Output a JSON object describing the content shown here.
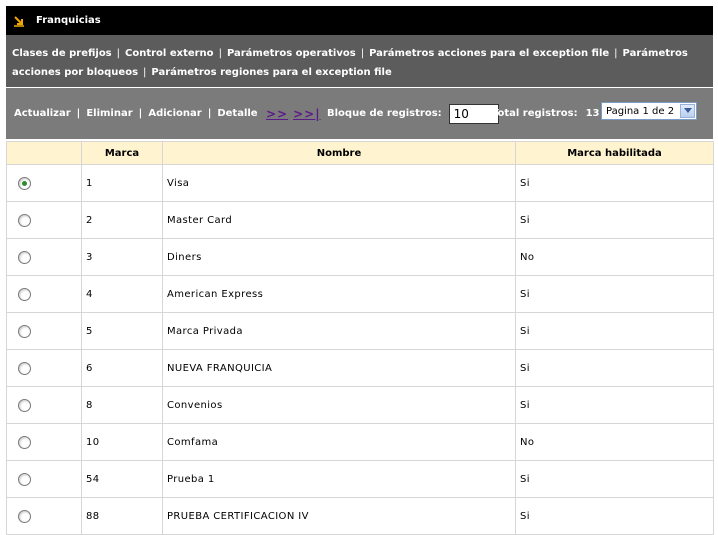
{
  "header": {
    "title": "Franquicias",
    "icon": "arrow-down-right-icon"
  },
  "nav": {
    "links": [
      "Clases de prefijos",
      "Control externo",
      "Parámetros operativos",
      "Parámetros acciones para el exception file",
      "Parámetros acciones por bloqueos",
      "Parámetros regiones para el exception file"
    ]
  },
  "toolbar": {
    "actions": [
      "Actualizar",
      "Eliminar",
      "Adicionar",
      "Detalle"
    ],
    "next_label": ">>",
    "last_label": ">>|",
    "block_label": "Bloque de registros:",
    "block_value": "10",
    "total_label": "Total registros:",
    "total_value": "13",
    "page_select": "Pagina 1 de 2"
  },
  "table": {
    "columns": [
      "",
      "Marca",
      "Nombre",
      "Marca habilitada"
    ],
    "rows": [
      {
        "selected": true,
        "marca": "1",
        "nombre": "Visa",
        "habilitada": "Si"
      },
      {
        "selected": false,
        "marca": "2",
        "nombre": "Master Card",
        "habilitada": "Si"
      },
      {
        "selected": false,
        "marca": "3",
        "nombre": "Diners",
        "habilitada": "No"
      },
      {
        "selected": false,
        "marca": "4",
        "nombre": "American Express",
        "habilitada": "Si"
      },
      {
        "selected": false,
        "marca": "5",
        "nombre": "Marca Privada",
        "habilitada": "Si"
      },
      {
        "selected": false,
        "marca": "6",
        "nombre": "NUEVA FRANQUICIA",
        "habilitada": "Si"
      },
      {
        "selected": false,
        "marca": "8",
        "nombre": "Convenios",
        "habilitada": "Si"
      },
      {
        "selected": false,
        "marca": "10",
        "nombre": "Comfama",
        "habilitada": "No"
      },
      {
        "selected": false,
        "marca": "54",
        "nombre": "Prueba 1",
        "habilitada": "Si"
      },
      {
        "selected": false,
        "marca": "88",
        "nombre": "PRUEBA CERTIFICACION IV",
        "habilitada": "Si"
      }
    ]
  }
}
